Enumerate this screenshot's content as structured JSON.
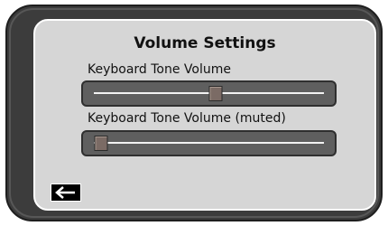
{
  "title": "Volume Settings",
  "sliders": [
    {
      "label": "Keyboard Tone Volume",
      "value_fraction": 0.53
    },
    {
      "label": "Keyboard Tone Volume (muted)",
      "value_fraction": 0.03
    }
  ],
  "back_icon": "left-arrow-icon"
}
